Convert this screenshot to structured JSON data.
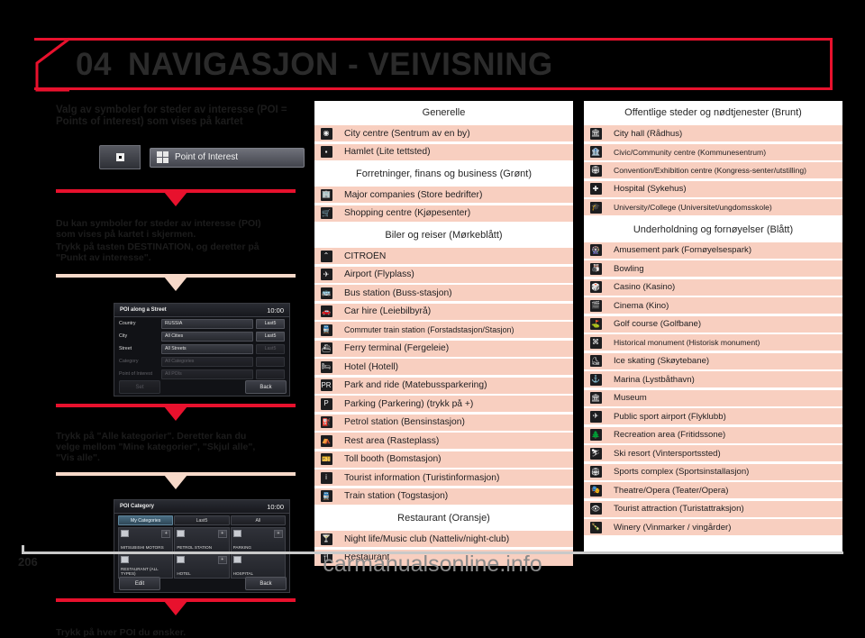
{
  "header": {
    "chapter_number": "04",
    "title": "NAVIGASJON - VEIVISNING",
    "accent_color": "#e8112d",
    "title_color": "#2b2b2b"
  },
  "left_column": {
    "lead_title": "Valg av symboler for steder av interesse (POI = Points of interest) som vises på kartet",
    "poi_button": {
      "label": "Point of Interest",
      "icon": "four-squares-icon"
    },
    "paragraph_1_line_1": "Du kan symboler for steder av interesse (POI)",
    "paragraph_1_line_2": "som vises på kartet i skjermen.",
    "paragraph_2_line_1": "Trykk på tasten DESTINATION, og deretter på",
    "paragraph_2_line_2": "\"Punkt av interesse\".",
    "paragraph_3_line_1": "Trykk på \"Alle kategorier\". Deretter kan du",
    "paragraph_3_line_2": "velge mellom \"Mine kategorier\", \"Skjul alle\",",
    "paragraph_3_line_3": "\"Vis alle\".",
    "paragraph_4": "Trykk på hver POI du ønsker.",
    "screenshot_1": {
      "title": "POI along a Street",
      "clock": "10:00",
      "fields": [
        {
          "label": "Country",
          "value": "RUSSIA",
          "button": "Last5",
          "dim": false
        },
        {
          "label": "City",
          "value": "All Cities",
          "button": "Last5",
          "dim": false
        },
        {
          "label": "Street",
          "value": "All Streets",
          "button": "Last5",
          "dim": false
        },
        {
          "label": "Category",
          "value": "All Categories",
          "button": "",
          "dim": true
        },
        {
          "label": "Point of Interest",
          "value": "All POIs",
          "button": "",
          "dim": true
        }
      ],
      "set_button": "Set",
      "back_button": "Back"
    },
    "screenshot_2": {
      "title": "POI Category",
      "clock": "10:00",
      "tabs": [
        "My Categories",
        "Last5",
        "All"
      ],
      "active_tab": "My Categories",
      "cells": [
        {
          "text": "MITSUBISHI MOTORS",
          "plus": "+"
        },
        {
          "text": "PETROL STATION",
          "plus": "+"
        },
        {
          "text": "PARKING",
          "plus": "+"
        },
        {
          "text": "RESTAURANT (ALL TYPES)",
          "plus": ""
        },
        {
          "text": "HOTEL",
          "plus": "+"
        },
        {
          "text": "HOSPITAL",
          "plus": ""
        }
      ],
      "edit_button": "Edit",
      "back_button": "Back"
    }
  },
  "middle_column": {
    "sections": [
      {
        "heading": "Generelle",
        "rows": [
          {
            "label": "City centre (Sentrum av en by)",
            "icon": "city-centre-icon",
            "glyph": "◉",
            "small": false
          },
          {
            "label": "Hamlet (Lite tettsted)",
            "icon": "hamlet-icon",
            "glyph": "▪",
            "small": false
          }
        ]
      },
      {
        "heading": "Forretninger, finans og business (Grønt)",
        "rows": [
          {
            "label": "Major companies (Store bedrifter)",
            "icon": "major-companies-icon",
            "glyph": "🏢",
            "small": false
          },
          {
            "label": "Shopping centre (Kjøpesenter)",
            "icon": "shopping-centre-icon",
            "glyph": "🛒",
            "small": false
          }
        ]
      },
      {
        "heading": "Biler og reiser (Mørkeblått)",
        "rows": [
          {
            "label": "CITROËN",
            "icon": "citroen-icon",
            "glyph": "⌃",
            "small": false
          },
          {
            "label": "Airport (Flyplass)",
            "icon": "airport-icon",
            "glyph": "✈",
            "small": false
          },
          {
            "label": "Bus station (Buss-stasjon)",
            "icon": "bus-station-icon",
            "glyph": "🚌",
            "small": false
          },
          {
            "label": "Car hire (Leiebilbyrå)",
            "icon": "car-hire-icon",
            "glyph": "🚗",
            "small": false
          },
          {
            "label": "Commuter train station (Forstadstasjon/Stasjon)",
            "icon": "commuter-train-icon",
            "glyph": "🚆",
            "small": true
          },
          {
            "label": "Ferry terminal (Fergeleie)",
            "icon": "ferry-terminal-icon",
            "glyph": "⛴",
            "small": false
          },
          {
            "label": "Hotel (Hotell)",
            "icon": "hotel-icon",
            "glyph": "🛏",
            "small": false
          },
          {
            "label": "Park and ride (Matebussparkering)",
            "icon": "park-and-ride-icon",
            "glyph": "PR",
            "small": false
          },
          {
            "label": "Parking (Parkering) (trykk på +)",
            "icon": "parking-icon",
            "glyph": "P",
            "small": false
          },
          {
            "label": "Petrol station (Bensinstasjon)",
            "icon": "petrol-station-icon",
            "glyph": "⛽",
            "small": false
          },
          {
            "label": "Rest area (Rasteplass)",
            "icon": "rest-area-icon",
            "glyph": "⛺",
            "small": false
          },
          {
            "label": "Toll booth (Bomstasjon)",
            "icon": "toll-booth-icon",
            "glyph": "🎫",
            "small": false
          },
          {
            "label": "Tourist information (Turistinformasjon)",
            "icon": "tourist-information-icon",
            "glyph": "i",
            "small": false
          },
          {
            "label": "Train station (Togstasjon)",
            "icon": "train-station-icon",
            "glyph": "🚆",
            "small": false
          }
        ]
      },
      {
        "heading": "Restaurant (Oransje)",
        "rows": [
          {
            "label": "Night life/Music club (Natteliv/night-club)",
            "icon": "night-life-icon",
            "glyph": "🍸",
            "small": false
          },
          {
            "label": "Restaurant",
            "icon": "restaurant-icon",
            "glyph": "🍴",
            "small": false
          }
        ]
      }
    ]
  },
  "right_column": {
    "sections": [
      {
        "heading": "Offentlige steder og nødtjenester (Brunt)",
        "rows": [
          {
            "label": "City hall (Rådhus)",
            "icon": "city-hall-icon",
            "glyph": "🏛",
            "small": false
          },
          {
            "label": "Civic/Community centre (Kommunesentrum)",
            "icon": "civic-centre-icon",
            "glyph": "🏦",
            "small": true
          },
          {
            "label": "Convention/Exhibition centre (Kongress-senter/utstilling)",
            "icon": "convention-centre-icon",
            "glyph": "🏟",
            "small": true
          },
          {
            "label": "Hospital (Sykehus)",
            "icon": "hospital-icon",
            "glyph": "✚",
            "small": false
          },
          {
            "label": "University/College (Universitet/ungdomsskole)",
            "icon": "university-icon",
            "glyph": "🎓",
            "small": true
          }
        ]
      },
      {
        "heading": "Underholdning og fornøyelser (Blått)",
        "rows": [
          {
            "label": "Amusement park (Fornøyelsespark)",
            "icon": "amusement-park-icon",
            "glyph": "🎡",
            "small": false
          },
          {
            "label": "Bowling",
            "icon": "bowling-icon",
            "glyph": "🎳",
            "small": false
          },
          {
            "label": "Casino (Kasino)",
            "icon": "casino-icon",
            "glyph": "🎲",
            "small": false
          },
          {
            "label": "Cinema (Kino)",
            "icon": "cinema-icon",
            "glyph": "🎬",
            "small": false
          },
          {
            "label": "Golf course (Golfbane)",
            "icon": "golf-course-icon",
            "glyph": "⛳",
            "small": false
          },
          {
            "label": "Historical monument (Historisk monument)",
            "icon": "historical-monument-icon",
            "glyph": "⌘",
            "small": true
          },
          {
            "label": "Ice skating (Skøytebane)",
            "icon": "ice-skating-icon",
            "glyph": "⛸",
            "small": false
          },
          {
            "label": "Marina (Lystbåthavn)",
            "icon": "marina-icon",
            "glyph": "⚓",
            "small": false
          },
          {
            "label": "Museum",
            "icon": "museum-icon",
            "glyph": "🏛",
            "small": false
          },
          {
            "label": "Public sport airport (Flyklubb)",
            "icon": "public-sport-airport-icon",
            "glyph": "✈",
            "small": false
          },
          {
            "label": "Recreation area (Fritidssone)",
            "icon": "recreation-area-icon",
            "glyph": "🌲",
            "small": false
          },
          {
            "label": "Ski resort (Vintersportssted)",
            "icon": "ski-resort-icon",
            "glyph": "⛷",
            "small": false
          },
          {
            "label": "Sports complex (Sportsinstallasjon)",
            "icon": "sports-complex-icon",
            "glyph": "🏟",
            "small": false
          },
          {
            "label": "Theatre/Opera (Teater/Opera)",
            "icon": "theatre-opera-icon",
            "glyph": "🎭",
            "small": false
          },
          {
            "label": "Tourist attraction (Turistattraksjon)",
            "icon": "tourist-attraction-icon",
            "glyph": "👁",
            "small": false
          },
          {
            "label": "Winery (Vinmarker / vingårder)",
            "icon": "winery-icon",
            "glyph": "🍾",
            "small": false
          }
        ]
      }
    ]
  },
  "footer": {
    "page_number": "206",
    "watermark": "carmanualsonline.info"
  }
}
